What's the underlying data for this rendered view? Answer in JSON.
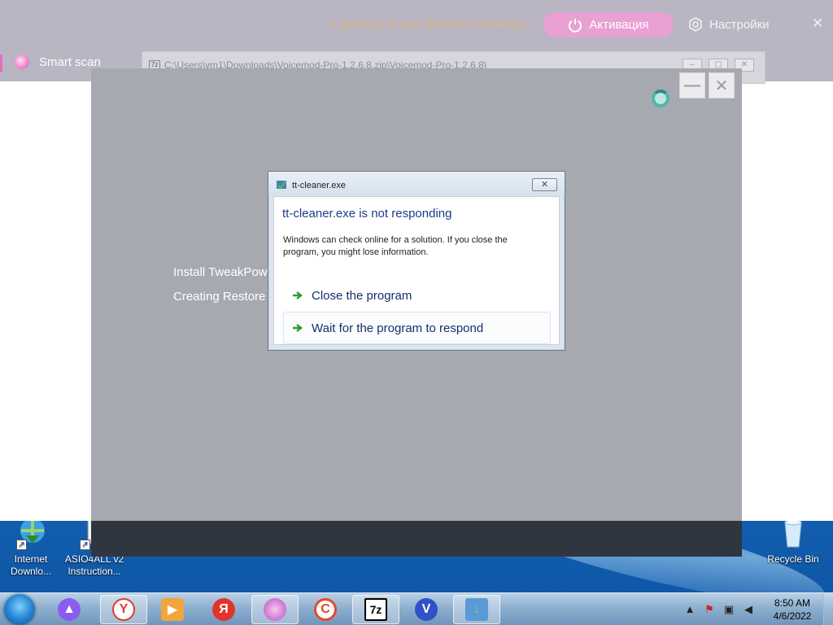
{
  "background_app": {
    "trial_text": "6 дней до конца пробного периода",
    "activate_label": "Активация",
    "settings_label": "Настройки",
    "close_glyph": "✕",
    "nav_item": "Smart scan"
  },
  "path_window": {
    "title": "C:\\Users\\vm1\\Downloads\\Voicemod-Pro-1.2.6.8.zip\\Voicemod-Pro-1.2.6.8\\"
  },
  "installer": {
    "line1": "Install TweakPowe",
    "line2": "Creating Restore I",
    "minimize_glyph": "—",
    "close_glyph": "✕"
  },
  "dialog": {
    "title": "tt-cleaner.exe",
    "close_glyph": "✕",
    "heading": "tt-cleaner.exe is not responding",
    "description": "Windows can check online for a solution. If you close the program, you might lose information.",
    "option_close": "Close the program",
    "option_wait": "Wait for the program to respond"
  },
  "desktop": {
    "icons": [
      {
        "label": "Internet Downlo..."
      },
      {
        "label": "ASIO4ALL v2 Instruction..."
      },
      {
        "label": "Recycle Bin"
      }
    ]
  },
  "taskbar": {
    "apps": [
      "Alice",
      "Yandex Browser",
      "Video Player",
      "Yandex",
      "TweakPower",
      "CCleaner",
      "7-Zip",
      "Voicemod",
      "Installer"
    ],
    "time": "8:50 AM",
    "date": "4/6/2022"
  },
  "colors": {
    "accent_pink": "#e9a0d3",
    "dialog_heading": "#1e3a8a",
    "arrow_green": "#2e9a2e"
  }
}
